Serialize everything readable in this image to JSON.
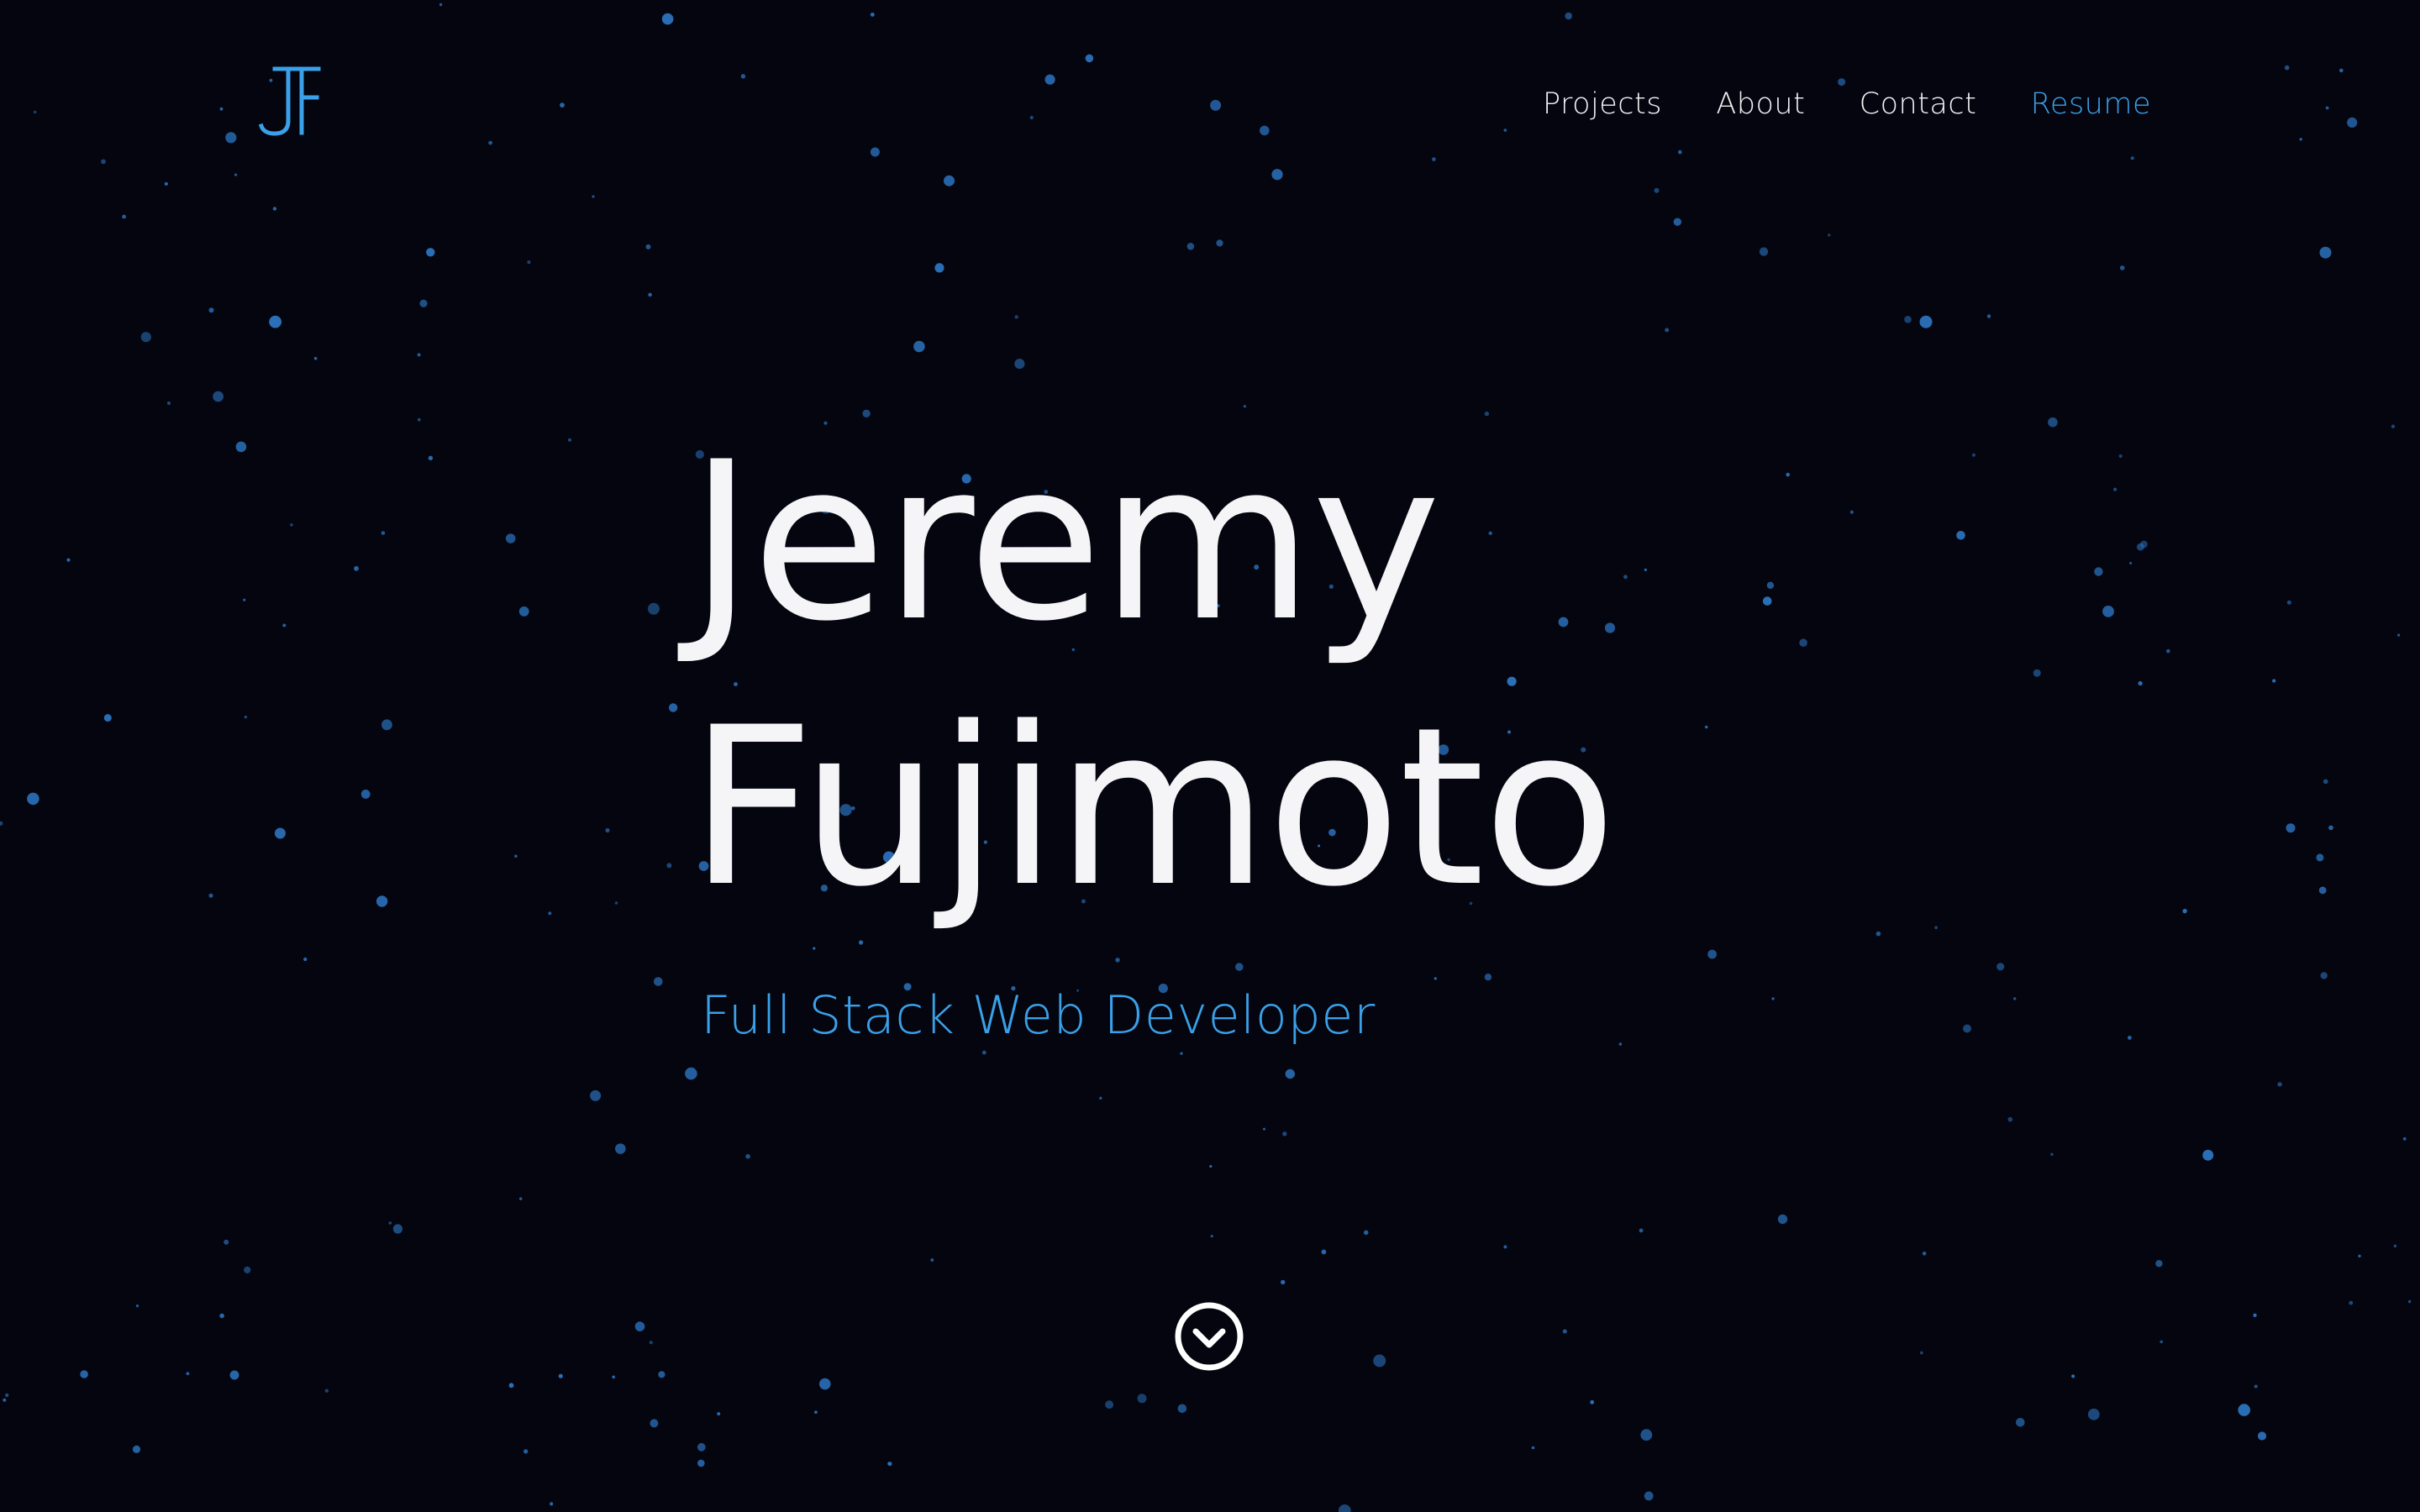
{
  "brand": {
    "logo_text": "JF",
    "logo_color": "#3aa0e8"
  },
  "nav": {
    "items": [
      {
        "label": "Projects"
      },
      {
        "label": "About"
      },
      {
        "label": "Contact"
      },
      {
        "label": "Resume"
      }
    ]
  },
  "hero": {
    "first_name": "Jeremy",
    "last_name": "Fujimoto",
    "subtitle": "Full Stack Web Developer"
  },
  "scroll_icon": "chevron-down-circle-icon",
  "colors": {
    "background": "#04050f",
    "accent": "#3aa0e8",
    "text": "#f5f5f7",
    "star": "#2a6fb8"
  }
}
